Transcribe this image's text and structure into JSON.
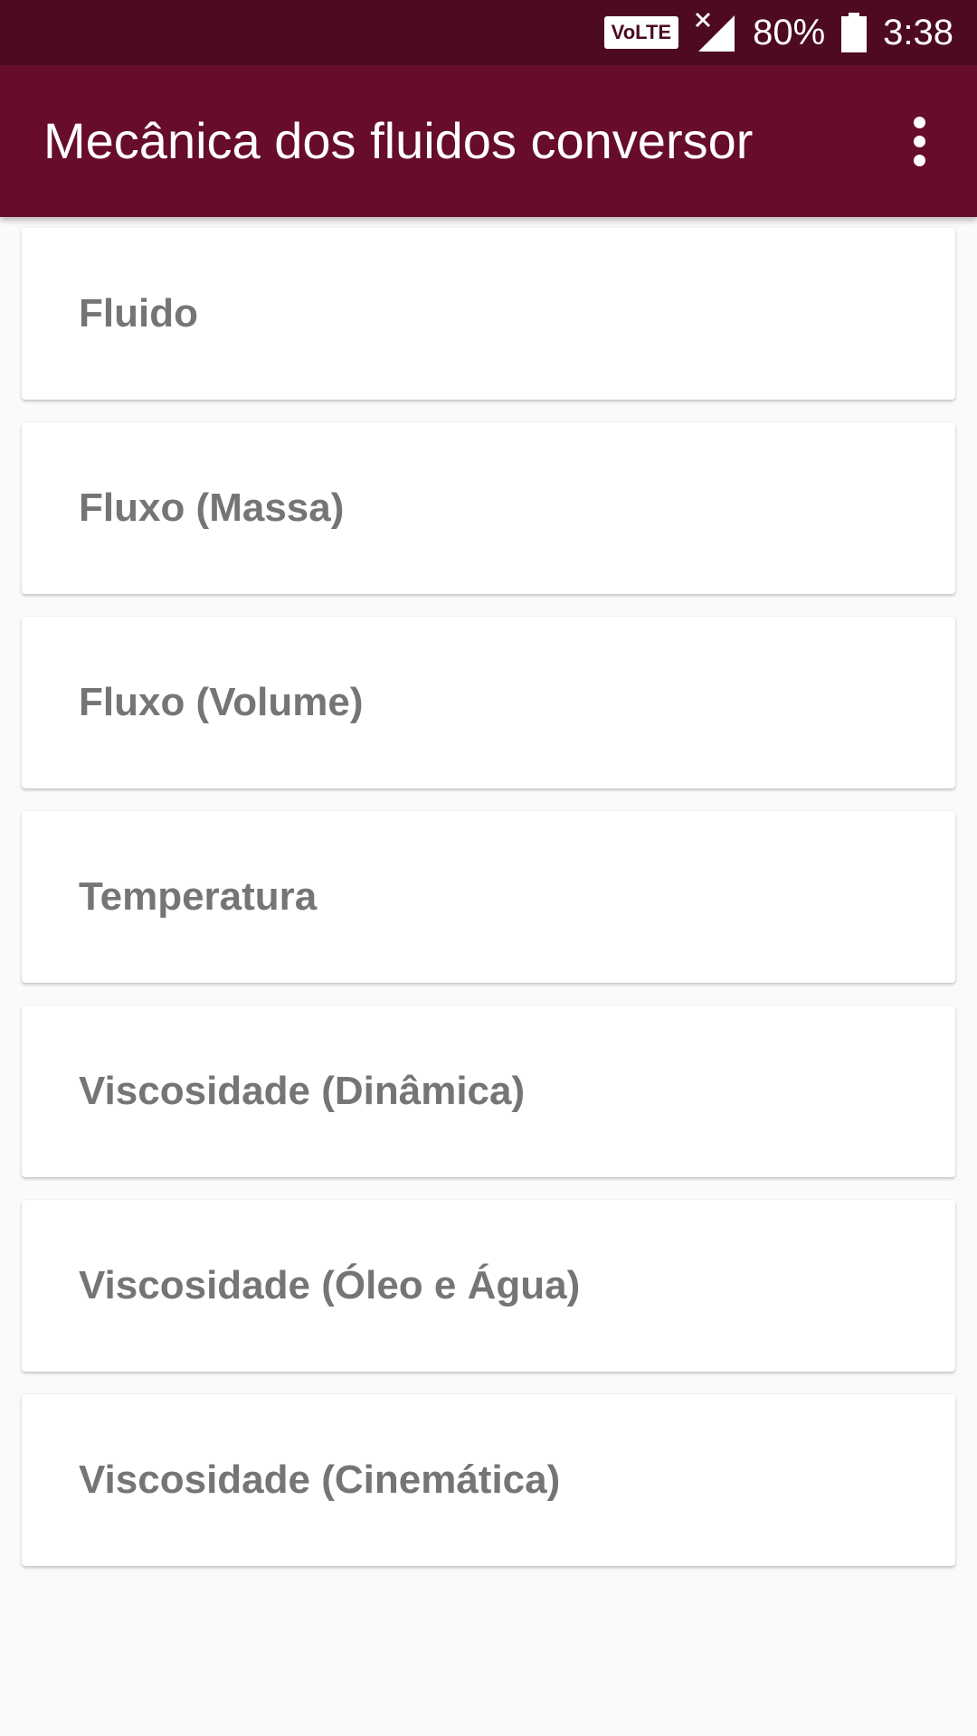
{
  "status_bar": {
    "volte": "VoLTE",
    "battery": "80%",
    "time": "3:38",
    "icons": [
      "volte-icon",
      "signal-no-sim-icon",
      "battery-icon"
    ]
  },
  "app_bar": {
    "title": "Mecânica dos fluidos conversor",
    "menu_icon": "more-vert-icon",
    "background_color": "#670c2b"
  },
  "list": {
    "items": [
      {
        "label": "Fluido"
      },
      {
        "label": "Fluxo (Massa)"
      },
      {
        "label": "Fluxo (Volume)"
      },
      {
        "label": "Temperatura"
      },
      {
        "label": "Viscosidade (Dinâmica)"
      },
      {
        "label": "Viscosidade (Óleo e Água)"
      },
      {
        "label": "Viscosidade (Cinemática)"
      }
    ]
  },
  "colors": {
    "status_bar": "#4d0a20",
    "app_bar": "#670c2b",
    "item_text": "#757575",
    "background": "#fafafa"
  }
}
